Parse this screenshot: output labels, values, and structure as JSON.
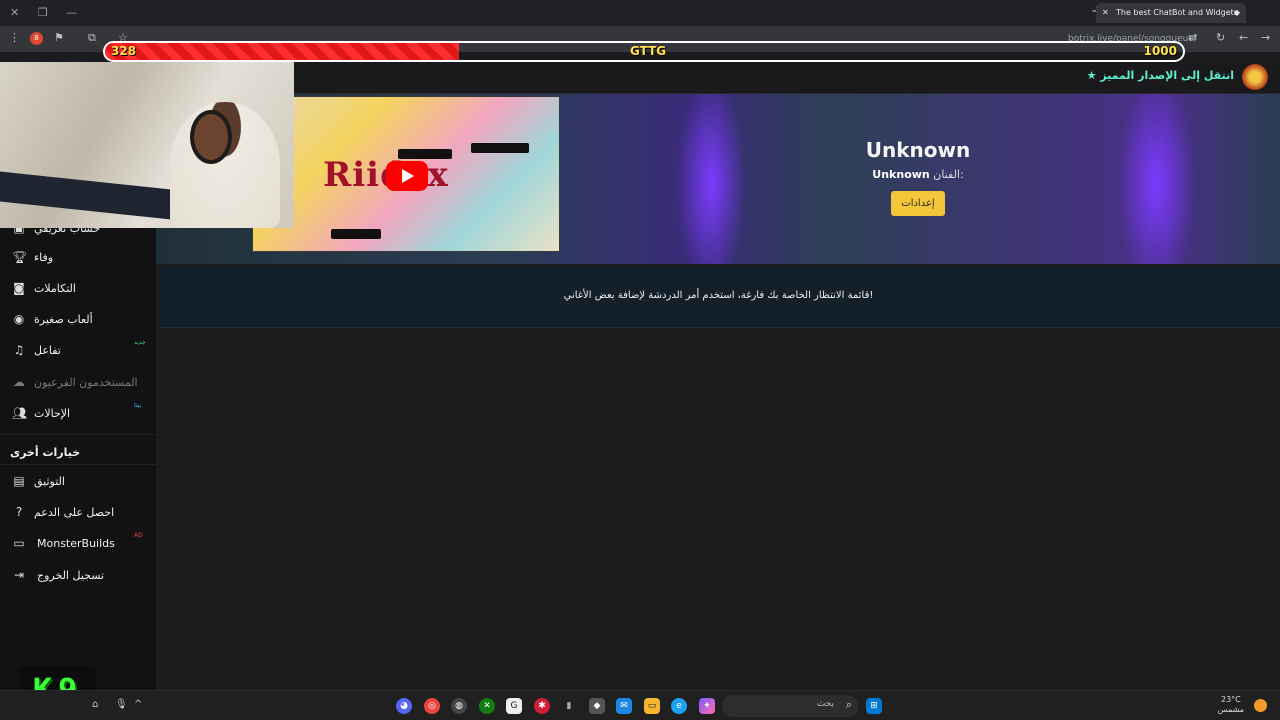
{
  "browser": {
    "tab_title": "The best ChatBot and Widgets",
    "url": "botrix.live/panel/songqueue/"
  },
  "overlay_bar": {
    "current": "328",
    "label": "GTTG",
    "max": "1000",
    "progress": 0.328,
    "fill_color": "#ff2d2d"
  },
  "header": {
    "premium_link": "انتقل إلى الإصدار المميز"
  },
  "sidebar": {
    "items": [
      {
        "label": "حساب تعريفي",
        "icon": "profile-icon"
      },
      {
        "label": "وفاء",
        "icon": "trophy-icon"
      },
      {
        "label": "التكاملات",
        "icon": "integrations-icon"
      },
      {
        "label": "ألعاب صغيرة",
        "icon": "gamepad-icon"
      },
      {
        "label": "تفاعل",
        "icon": "music-icon",
        "badge": "جديد"
      },
      {
        "label": "المستخدمون الفرعيون",
        "icon": "subusers-icon"
      },
      {
        "label": "الإحالات",
        "icon": "users-icon",
        "badge": "بيتا"
      }
    ],
    "other_title": "خيارات أخرى",
    "other_items": [
      {
        "label": "التوثيق",
        "icon": "docs-icon"
      },
      {
        "label": "احصل على الدعم",
        "icon": "help-icon"
      },
      {
        "label": "MonsterBuilds",
        "icon": "laptop-icon",
        "badge": "AD"
      },
      {
        "label": "تسجيل الخروج",
        "icon": "logout-icon"
      }
    ]
  },
  "now_playing": {
    "title": "Unknown",
    "artist_label": "الفنان:",
    "artist": "Unknown",
    "settings_button": "إعدادات",
    "thumbnail_text": "Riidex"
  },
  "queue": {
    "empty_message": "قائمة الانتظار الخاصة بك فارغة، استخدم أمر الدردشة لإضافة بعض الأغاني!"
  },
  "stream_overlay": {
    "logo_text": "K9"
  },
  "taskbar": {
    "search_placeholder": "بحث",
    "weather_temp": "23°C",
    "weather_text": "مشمس"
  }
}
